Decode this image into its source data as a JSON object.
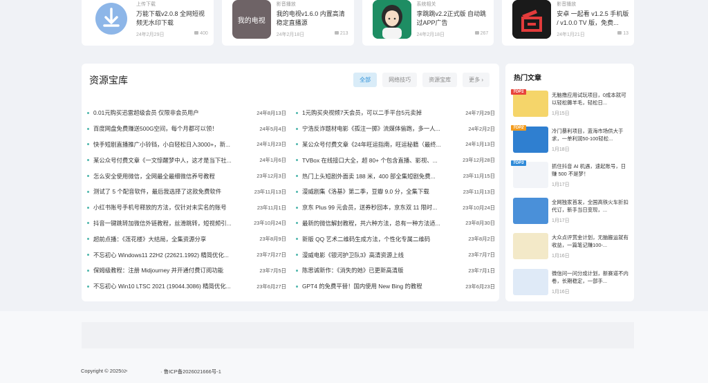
{
  "top_apps": [
    {
      "tag": "上传下载",
      "title": "万能下载v2.0.8 全网短视频无水印下载",
      "date": "24年2月29日",
      "count": "400",
      "icon": "download-icon",
      "color": "#8db6e8"
    },
    {
      "tag": "影音播放",
      "title": "我的电视v1.6.0 内置高清稳定直播源",
      "date": "24年2月18日",
      "count": "213",
      "icon": "tv-icon",
      "color": "#6e6366",
      "icon_text": "我的电视"
    },
    {
      "tag": "系统相关",
      "title": "李跳跳v2.2正式版 自动跳过APP广告",
      "date": "24年2月18日",
      "count": "267",
      "icon": "girl-avatar-icon",
      "color": "#1e8d63"
    },
    {
      "tag": "影音播放",
      "title": "安卓 一起看 v1.2.5 手机版 / v1.0.0 TV 版，免费...",
      "date": "24年1月21日",
      "count": "13",
      "icon": "tv-box-icon",
      "color": "#1a1a1a"
    }
  ],
  "resources": {
    "title": "资源宝库",
    "tabs": [
      "全部",
      "网络技巧",
      "资源宝库",
      "更多 ›"
    ],
    "left": [
      {
        "text": "0.01元购买迅雷超级会员 仅限非会员用户",
        "date": "24年8月13日"
      },
      {
        "text": "百度网盘免费赚送500G空间，每个月都可以领！",
        "date": "24年5月4日"
      },
      {
        "text": "快手短剧直播推广小铃铛，小白轻松日入3000+，新...",
        "date": "24年1月23日"
      },
      {
        "text": "某公众号付费文章《一文惊醒梦中人，这才是当下社...",
        "date": "24年1月6日"
      },
      {
        "text": "怎么安全使用微信，全网最全最细微信养号教程",
        "date": "23年12月3日"
      },
      {
        "text": "测试了 5 个配音软件，最后我选择了这款免费软件",
        "date": "23年11月13日"
      },
      {
        "text": "小红书账号手机号释放的方法，仅针对未实名的账号",
        "date": "23年11月1日"
      },
      {
        "text": "抖音一键跳转加微信外链教程，丝滑跳转，短视频引...",
        "date": "23年10月24日"
      },
      {
        "text": "超前点播：《莲花楼》大结局，全集资源分享",
        "date": "23年8月9日"
      },
      {
        "text": "不忘初心 Windows11 22H2 (22621.1992) 精简优化...",
        "date": "23年7月27日"
      },
      {
        "text": "保姆级教程：注册 Midjourney 并开通付费订阅功能",
        "date": "23年7月5日"
      },
      {
        "text": "不忘初心 Win10 LTSC 2021 (19044.3086) 精简优化...",
        "date": "23年6月27日"
      }
    ],
    "right": [
      {
        "text": "1元购买央视频7天会员，可以二手平台5元卖掉",
        "date": "24年7月29日"
      },
      {
        "text": "宁浩反诈题材电影《孤注一掷》流媒体偷跑，多一人...",
        "date": "24年2月2日"
      },
      {
        "text": "某公众号付费文章《24年旺运指南，旺运秘籍（最终...",
        "date": "24年1月13日"
      },
      {
        "text": "TVBox 在线接口大全，超 80+ 个包含直播、影视、...",
        "date": "23年12月28日"
      },
      {
        "text": "热门上头短剧外面卖 188 米，400 部全集短剧免费...",
        "date": "23年11月15日"
      },
      {
        "text": "漫威剧集《洛基》第二季，豆瓣 9.0 分，全集下载",
        "date": "23年11月13日"
      },
      {
        "text": "京东 Plus 99 元会员，送券秒回本，京东双 11 限时...",
        "date": "23年10月24日"
      },
      {
        "text": "最新的微信解封教程，共六种方法，总有一种方法适...",
        "date": "23年8月30日"
      },
      {
        "text": "新版 QQ 艺术二维码生成方法，个性化专属二维码",
        "date": "23年8月2日"
      },
      {
        "text": "漫威电影《银河护卫队3》高清资源上线",
        "date": "23年7月7日"
      },
      {
        "text": "陈思诚新作：《消失的她》已更新高清版",
        "date": "23年7月1日"
      },
      {
        "text": "GPT4 的免费平替！国内使用 New Bing 的教程",
        "date": "23年6月23日"
      }
    ]
  },
  "hot": {
    "title": "热门文章",
    "items": [
      {
        "rank": "TOP1",
        "rank_color": "#e8453c",
        "text": "无脑撸应用试玩项目，0成本就可以轻松薅羊毛，轻松日...",
        "date": "1月15日",
        "thumb": "#f5d56a"
      },
      {
        "rank": "TOP2",
        "rank_color": "#f39c1f",
        "text": "冷门暴利项目，蓝海市场供大于求，一单利润50-100轻松...",
        "date": "1月18日",
        "thumb": "#2f7fd0"
      },
      {
        "rank": "TOP3",
        "rank_color": "#2f8ad8",
        "text": "抓住抖音 AI 机遇，速起账号，日赚 500 不是梦！",
        "date": "1月17日",
        "thumb": "#f2f4f8"
      },
      {
        "rank": "",
        "rank_color": "",
        "text": "全网独家首发，全国高铁火车折扣代订，新手当日变现，...",
        "date": "1月17日",
        "thumb": "#4a90d9"
      },
      {
        "rank": "",
        "rank_color": "",
        "text": "大众点评赏金计划，无脑搬运就有收益，一篇笔记赚100-...",
        "date": "1月16日",
        "thumb": "#f3e9c8"
      },
      {
        "rank": "",
        "rank_color": "",
        "text": "微信问一问分成计划，新赛道不内卷，长期稳定，一部手...",
        "date": "1月16日",
        "thumb": "#dfeaf7"
      }
    ]
  },
  "footer": {
    "copyright": "Copyright © 2025",
    "copyright_suffix": "02ᵉ",
    "icp": "· 鲁ICP备2026021666号-1"
  }
}
